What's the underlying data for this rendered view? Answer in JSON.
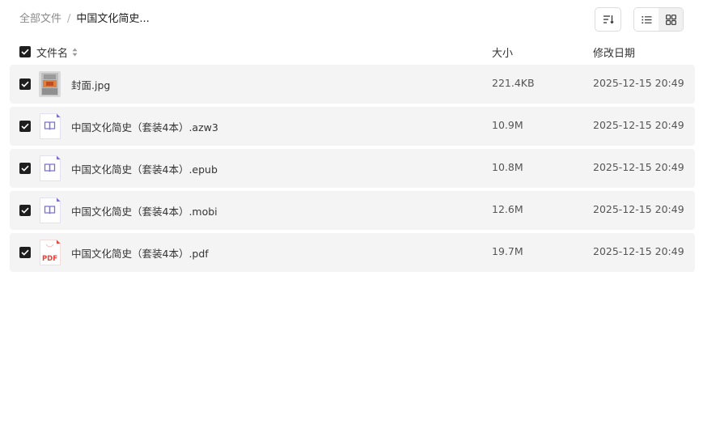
{
  "breadcrumb": {
    "root": "全部文件",
    "separator": "/",
    "current": "中国文化简史..."
  },
  "toolbar": {
    "sort_icon": "sort-list-icon",
    "list_view_icon": "list-view-icon",
    "grid_view_icon": "grid-view-icon",
    "active_view": "list"
  },
  "columns": {
    "name": "文件名",
    "size": "大小",
    "date": "修改日期"
  },
  "files": [
    {
      "name": "封面.jpg",
      "size": "221.4KB",
      "date": "2025-12-15 20:49",
      "type": "image",
      "checked": true
    },
    {
      "name": "中国文化简史（套装4本）.azw3",
      "size": "10.9M",
      "date": "2025-12-15 20:49",
      "type": "ebook",
      "checked": true
    },
    {
      "name": "中国文化简史（套装4本）.epub",
      "size": "10.8M",
      "date": "2025-12-15 20:49",
      "type": "ebook",
      "checked": true
    },
    {
      "name": "中国文化简史（套装4本）.mobi",
      "size": "12.6M",
      "date": "2025-12-15 20:49",
      "type": "ebook",
      "checked": true
    },
    {
      "name": "中国文化简史（套装4本）.pdf",
      "size": "19.7M",
      "date": "2025-12-15 20:49",
      "type": "pdf",
      "checked": true
    }
  ],
  "icons": {
    "pdf_label": "PDF"
  },
  "colors": {
    "ebook_accent": "#7b6fd6",
    "pdf_accent": "#e8453c",
    "row_bg": "#f4f4f4",
    "checkbox": "#1f1f1f"
  }
}
